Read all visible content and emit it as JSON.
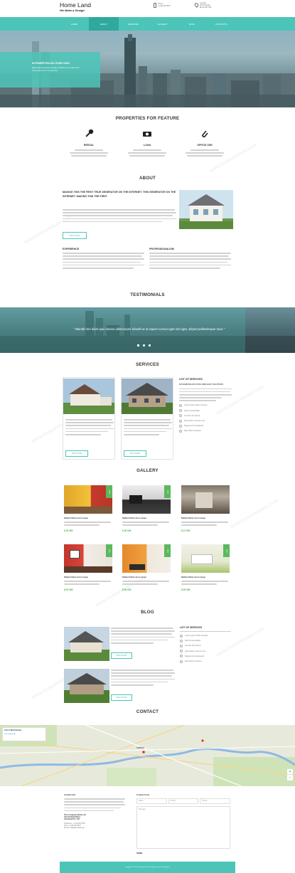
{
  "header": {
    "logo_title": "Home Land",
    "logo_tagline": "We Make a Design",
    "phone_label": "Phone:",
    "phone_value": "+1 234 567 8977",
    "location_label": "Location:",
    "location_line1": "256 Q5 Road",
    "location_line2": "Bronxi 987 456"
  },
  "nav": {
    "items": [
      "HOME",
      "ABOUT",
      "SERVICES",
      "GALLERY",
      "BLOG",
      "CONTACTS"
    ],
    "active_index": 1
  },
  "hero": {
    "heading": "IN PHARETRA DUI VITAE ODIO",
    "text": "Maecenas venenatis id nulla et ultricies sem euismod id maecenas rutrum dui rhoncus"
  },
  "features": {
    "title": "PROPERTIES FOR FEATURE",
    "items": [
      {
        "icon": "key-icon",
        "label": "RENTAL"
      },
      {
        "icon": "money-icon",
        "label": "LOAN"
      },
      {
        "icon": "paperclip-icon",
        "label": "OFFICE USE"
      }
    ]
  },
  "about": {
    "title": "ABOUT",
    "heading": "MAKING THIS THE FIRST TRUE GENERATOR ON THE INTERNET. THIS GENERATOR ON THE INTERNET. MAKING THIS THE FIRST",
    "read_more": "READ MORE",
    "experience_title": "EXPERIENCE",
    "professionalism_title": "PROFESSIONALISM"
  },
  "testimonials": {
    "title": "TESTIMONIALS",
    "quote": "\" Blandit non diam quis massa ullamcorper blandit ut at sapien cursus eget nisl eget, aliquet pellentesque nunc \""
  },
  "services": {
    "title": "SERVICES",
    "read_more": "READ MORE",
    "list_title": "LIST OF SERVICES",
    "list_subtitle": "IN PHARETRA DUI VITAE ODIO EGET VOLUTPATE",
    "list_items": [
      "Lorem ipsum dolor sit amet",
      "Sed ut perspiciatis",
      "Ut enim ad minima",
      "Quis autem vel eum iure",
      "Neque porro quisquam",
      "Nam libero tempore"
    ]
  },
  "gallery": {
    "title": "GALLERY",
    "tag": "NEW",
    "items": [
      {
        "caption": "Nullam finibus dui et neque",
        "price": "$ 25 000"
      },
      {
        "caption": "Nullam finibus dui et neque",
        "price": "$ 26 000"
      },
      {
        "caption": "Nullam finibus dui et neque",
        "price": "$ 27 000"
      },
      {
        "caption": "Nullam finibus dui et neque",
        "price": "$ 25 000"
      },
      {
        "caption": "Nullam finibus dui et neque",
        "price": "$ 26 000"
      },
      {
        "caption": "Nullam finibus dui et neque",
        "price": "$ 30 000"
      }
    ]
  },
  "blog": {
    "title": "BLOG",
    "read_more": "READ MORE",
    "list_title": "LIST OF SERVICES",
    "list_items": [
      "Lorem ipsum dolor sit amet",
      "Sed ut perspiciatis",
      "Ut enim ad minima",
      "Quis autem vel eum iure",
      "Neque porro quisquam",
      "Nam libero tempore"
    ]
  },
  "contact": {
    "title": "CONTACT",
    "map_place": "City of Westminster",
    "map_city": "London",
    "map_link": "View larger map",
    "info_title": "Contact Info",
    "company": "The Company Name Ltd",
    "address1": "1St Keyfield Place",
    "address2": "CD Road 87-7 2D",
    "telephone": "Telephone: +1 234 567 8977",
    "fax": "FAX: +1 234 567 8977",
    "email": "E-mail: mail@demolink.org",
    "form_title": "Contact Form",
    "name_placeholder": "Name:",
    "email_placeholder": "E-mail:",
    "phone_placeholder": "Phone:",
    "message_placeholder": "Message:",
    "send_label": "SEND",
    "zoom_in": "+",
    "zoom_out": "−"
  },
  "footer": {
    "copyright": "Copyright © 2016 Company name. All rights reserved. Templates"
  },
  "colors": {
    "accent": "#4cc5b8",
    "accent_dark": "#2fa89d",
    "footer_bg": "#4cc5b8",
    "price": "#4caf50"
  }
}
